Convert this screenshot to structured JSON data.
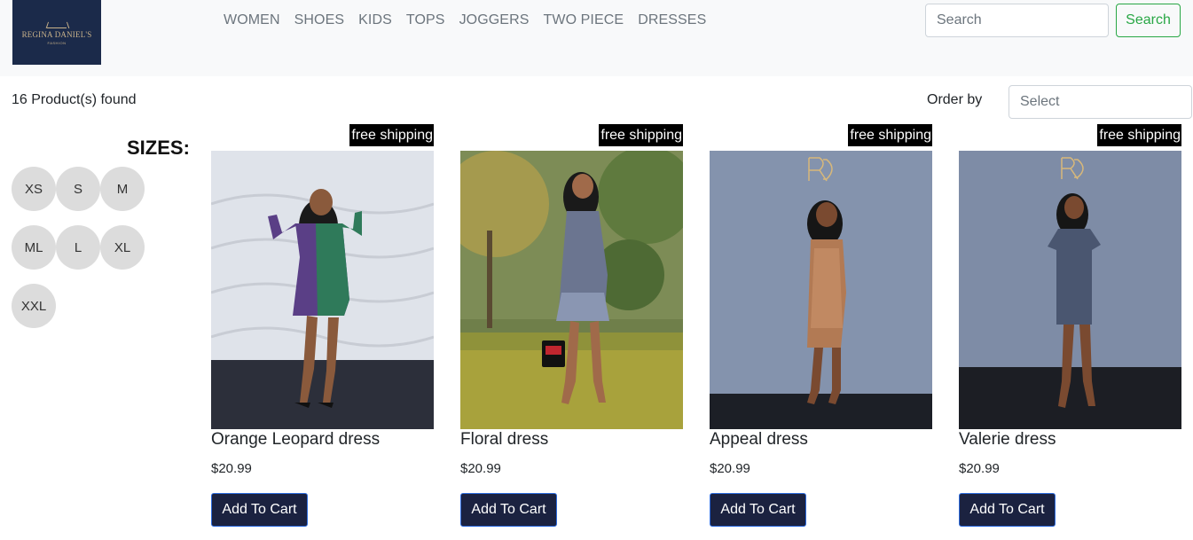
{
  "brand": {
    "logo_text": "REGINA DANIEL'S",
    "logo_sub": "FASHION"
  },
  "nav": {
    "items": [
      "WOMEN",
      "SHOES",
      "KIDS",
      "TOPS",
      "JOGGERS",
      "TWO PIECE",
      "DRESSES"
    ]
  },
  "search": {
    "placeholder": "Search",
    "button_label": "Search"
  },
  "filter": {
    "found_text": "16 Product(s) found",
    "order_label": "Order by",
    "order_placeholder": "Select"
  },
  "sizes": {
    "title": "SIZES:",
    "options": [
      "XS",
      "S",
      "M",
      "ML",
      "L",
      "XL",
      "XXL"
    ]
  },
  "products": [
    {
      "badge": "free shipping",
      "name": "Orange Leopard dress",
      "price": "$20.99",
      "cta": "Add To Cart"
    },
    {
      "badge": "free shipping",
      "name": "Floral dress",
      "price": "$20.99",
      "cta": "Add To Cart"
    },
    {
      "badge": "free shipping",
      "name": "Appeal dress",
      "price": "$20.99",
      "cta": "Add To Cart"
    },
    {
      "badge": "free shipping",
      "name": "Valerie dress",
      "price": "$20.99",
      "cta": "Add To Cart"
    }
  ],
  "colors": {
    "navbar_bg": "#f8f9fa",
    "logo_bg": "#1b2a4a",
    "accent_green": "#28a745",
    "cart_btn_bg": "#1b2240",
    "size_btn_bg": "#dcdcdc"
  }
}
